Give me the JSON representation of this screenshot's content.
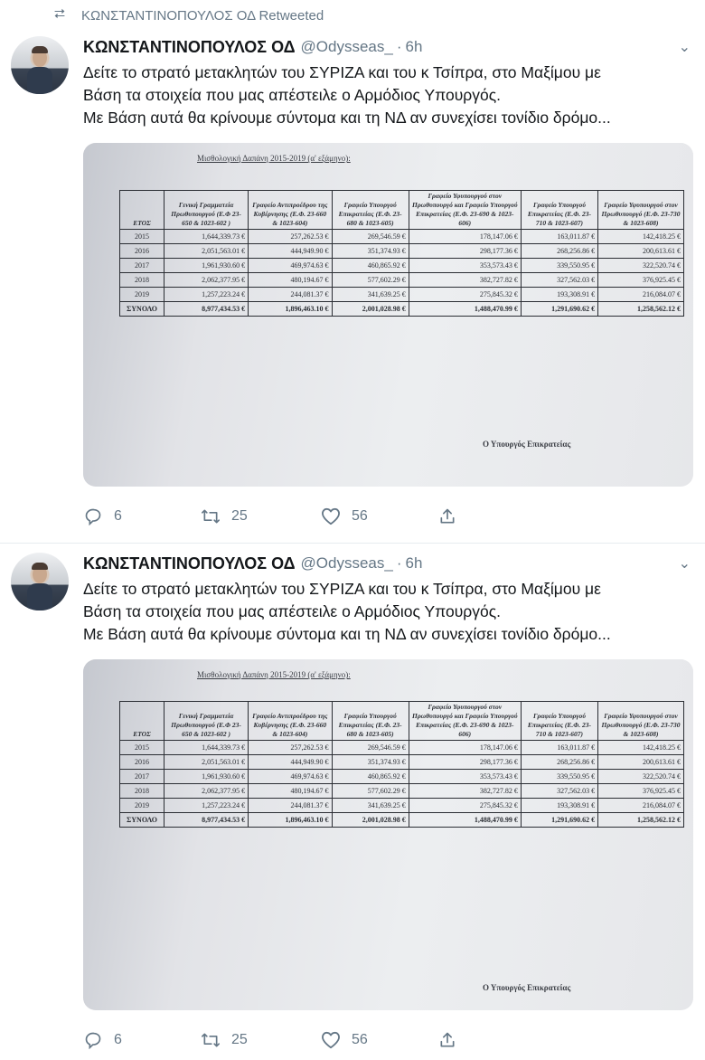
{
  "retweet_banner": {
    "text": "ΚΩΝΣΤΑΝΤΙΝΟΠΟΥΛΟΣ ΟΔ Retweeted"
  },
  "tweets": [
    {
      "author_name": "ΚΩΝΣΤΑΝΤΙΝΟΠΟΥΛΟΣ ΟΔ",
      "handle": "@Odysseas_",
      "separator": "·",
      "time": "6h",
      "lines": [
        "Δείτε το στρατό μετακλητών του ΣΥΡΙΖΑ και του κ Τσίπρα, στο Μαξίμου με",
        "Βάση τα στοιχεία που μας απέστειλε ο Αρμόδιος Υπουργός.",
        "Με Βάση αυτά θα κρίνουμε σύντομα και τη ΝΔ αν συνεχίσει τονίδιο δρόμο..."
      ],
      "replies": "6",
      "retweets": "25",
      "likes": "56"
    },
    {
      "author_name": "ΚΩΝΣΤΑΝΤΙΝΟΠΟΥΛΟΣ ΟΔ",
      "handle": "@Odysseas_",
      "separator": "·",
      "time": "6h",
      "lines": [
        "Δείτε το στρατό μετακλητών του ΣΥΡΙΖΑ και του κ Τσίπρα, στο Μαξίμου με",
        "Βάση τα στοιχεία που μας απέστειλε ο Αρμόδιος Υπουργός.",
        "Με Βάση αυτά θα κρίνουμε σύντομα και τη ΝΔ αν συνεχίσει τονίδιο δρόμο..."
      ],
      "replies": "6",
      "retweets": "25",
      "likes": "56"
    }
  ],
  "document": {
    "caption": "Μισθολογική Δαπάνη 2015-2019 (α' εξάμηνο):",
    "signature": "Ο Υπουργός Επικρατείας",
    "headers": [
      "ΕΤΟΣ",
      "Γενική Γραμματεία Πρωθυπουργού (Ε.Φ 23-650 & 1023-602 )",
      "Γραφείο Αντιπροέδρου της Κυβέρνησης (Ε.Φ. 23-660 & 1023-604)",
      "Γραφείο Υπουργού Επικρατείας (Ε.Φ. 23-680 & 1023-605)",
      "Γραφείο Υφυπουργού στον Πρωθυπουργό και Γραφείο Υπουργού Επικρατείας (Ε.Φ. 23-690 & 1023-606)",
      "Γραφείο Υπουργού Επικρατείας (Ε.Φ. 23-710 & 1023-607)",
      "Γραφείο Υφυπουργού στον Πρωθυπουργό (Ε.Φ. 23-730 & 1023-608)"
    ],
    "rows": [
      [
        "2015",
        "1,644,339.73 €",
        "257,262.53 €",
        "269,546.59 €",
        "178,147.06 €",
        "163,011.87 €",
        "142,418.25 €"
      ],
      [
        "2016",
        "2,051,563.01 €",
        "444,949.90 €",
        "351,374.93 €",
        "298,177.36 €",
        "268,256.86 €",
        "200,613.61 €"
      ],
      [
        "2017",
        "1,961,930.60 €",
        "469,974.63 €",
        "460,865.92 €",
        "353,573.43 €",
        "339,550.95 €",
        "322,520.74 €"
      ],
      [
        "2018",
        "2,062,377.95 €",
        "480,194.67 €",
        "577,602.29 €",
        "382,727.82 €",
        "327,562.03 €",
        "376,925.45 €"
      ],
      [
        "2019",
        "1,257,223.24 €",
        "244,081.37 €",
        "341,639.25 €",
        "275,845.32 €",
        "193,308.91 €",
        "216,084.07 €"
      ]
    ],
    "total": [
      "ΣΥΝΟΛΟ",
      "8,977,434.53 €",
      "1,896,463.10 €",
      "2,001,028.98 €",
      "1,488,470.99 €",
      "1,291,690.62 €",
      "1,258,562.12 €"
    ]
  }
}
